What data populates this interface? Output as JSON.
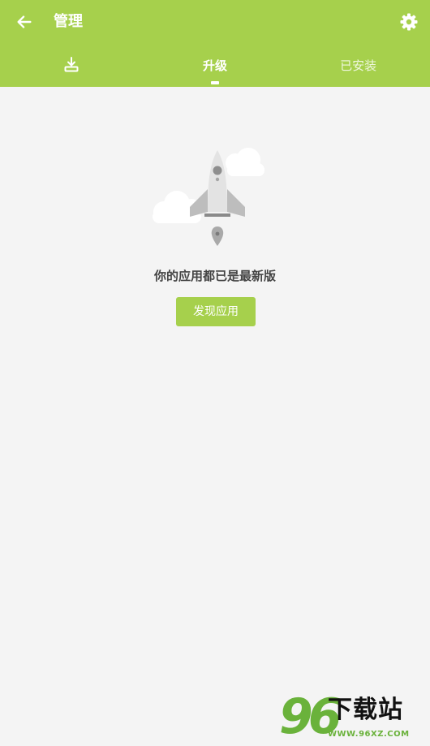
{
  "header": {
    "back_icon": "arrow-left-icon",
    "title": "管理",
    "settings_icon": "gear-icon"
  },
  "tabs": [
    {
      "label": "",
      "icon": "download-icon",
      "active": false
    },
    {
      "label": "升级",
      "active": true
    },
    {
      "label": "已安装",
      "active": false
    }
  ],
  "empty_state": {
    "illustration_icon": "rocket-icon",
    "message": "你的应用都已是最新版",
    "action_label": "发现应用"
  },
  "watermark": {
    "number": "96",
    "text": "下载站",
    "url": "WWW.96XZ.COM"
  },
  "colors": {
    "accent": "#a6d04c",
    "background": "#f4f4f4",
    "text": "#444444"
  }
}
